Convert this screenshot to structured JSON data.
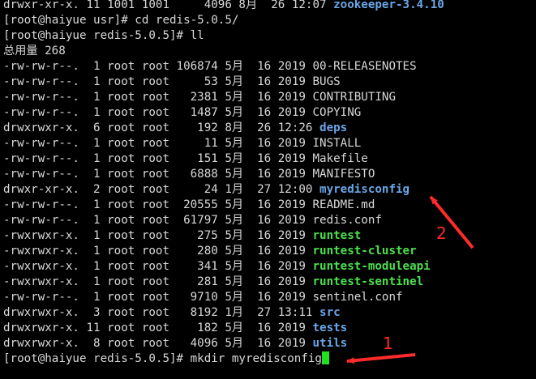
{
  "terminal": {
    "lines": [
      {
        "prefix": "drwxr-xr-x. 11 1001 1001     4096 8月  26 12:07 ",
        "name": "zookeeper-3.4.10",
        "kind": "dir"
      },
      {
        "prefix": "[root@haiyue usr]# cd redis-5.0.5/",
        "name": "",
        "kind": "text"
      },
      {
        "prefix": "[root@haiyue redis-5.0.5]# ll",
        "name": "",
        "kind": "text"
      },
      {
        "prefix": "总用量 268",
        "name": "",
        "kind": "text"
      },
      {
        "prefix": "-rw-rw-r--.  1 root root 106874 5月  16 2019 ",
        "name": "00-RELEASENOTES",
        "kind": "file"
      },
      {
        "prefix": "-rw-rw-r--.  1 root root     53 5月  16 2019 ",
        "name": "BUGS",
        "kind": "file"
      },
      {
        "prefix": "-rw-rw-r--.  1 root root   2381 5月  16 2019 ",
        "name": "CONTRIBUTING",
        "kind": "file"
      },
      {
        "prefix": "-rw-rw-r--.  1 root root   1487 5月  16 2019 ",
        "name": "COPYING",
        "kind": "file"
      },
      {
        "prefix": "drwxrwxr-x.  6 root root    192 8月  26 12:26 ",
        "name": "deps",
        "kind": "dir"
      },
      {
        "prefix": "-rw-rw-r--.  1 root root     11 5月  16 2019 ",
        "name": "INSTALL",
        "kind": "file"
      },
      {
        "prefix": "-rw-rw-r--.  1 root root    151 5月  16 2019 ",
        "name": "Makefile",
        "kind": "file"
      },
      {
        "prefix": "-rw-rw-r--.  1 root root   6888 5月  16 2019 ",
        "name": "MANIFESTO",
        "kind": "file"
      },
      {
        "prefix": "drwxr-xr-x.  2 root root     24 1月  27 12:00 ",
        "name": "myredisconfig",
        "kind": "dir"
      },
      {
        "prefix": "-rw-rw-r--.  1 root root  20555 5月  16 2019 ",
        "name": "README.md",
        "kind": "file"
      },
      {
        "prefix": "-rw-rw-r--.  1 root root  61797 5月  16 2019 ",
        "name": "redis.conf",
        "kind": "file"
      },
      {
        "prefix": "-rwxrwxr-x.  1 root root    275 5月  16 2019 ",
        "name": "runtest",
        "kind": "exe"
      },
      {
        "prefix": "-rwxrwxr-x.  1 root root    280 5月  16 2019 ",
        "name": "runtest-cluster",
        "kind": "exe"
      },
      {
        "prefix": "-rwxrwxr-x.  1 root root    341 5月  16 2019 ",
        "name": "runtest-moduleapi",
        "kind": "exe"
      },
      {
        "prefix": "-rwxrwxr-x.  1 root root    281 5月  16 2019 ",
        "name": "runtest-sentinel",
        "kind": "exe"
      },
      {
        "prefix": "-rw-rw-r--.  1 root root   9710 5月  16 2019 ",
        "name": "sentinel.conf",
        "kind": "file"
      },
      {
        "prefix": "drwxrwxr-x.  3 root root   8192 1月  27 13:11 ",
        "name": "src",
        "kind": "dir"
      },
      {
        "prefix": "drwxrwxr-x. 11 root root    182 5月  16 2019 ",
        "name": "tests",
        "kind": "dir"
      },
      {
        "prefix": "drwxrwxr-x.  8 root root   4096 5月  16 2019 ",
        "name": "utils",
        "kind": "dir"
      },
      {
        "prefix": "[root@haiyue redis-5.0.5]# mkdir myredisconfig",
        "name": "",
        "kind": "prompt"
      }
    ]
  },
  "annotations": {
    "label_1": "1",
    "label_2": "2",
    "color": "#ff2a2a"
  },
  "colors": {
    "background": "#000000",
    "text": "#d8d8d8",
    "directory": "#6aa6e8",
    "executable": "#4ce04c",
    "cursor": "#22e022"
  }
}
